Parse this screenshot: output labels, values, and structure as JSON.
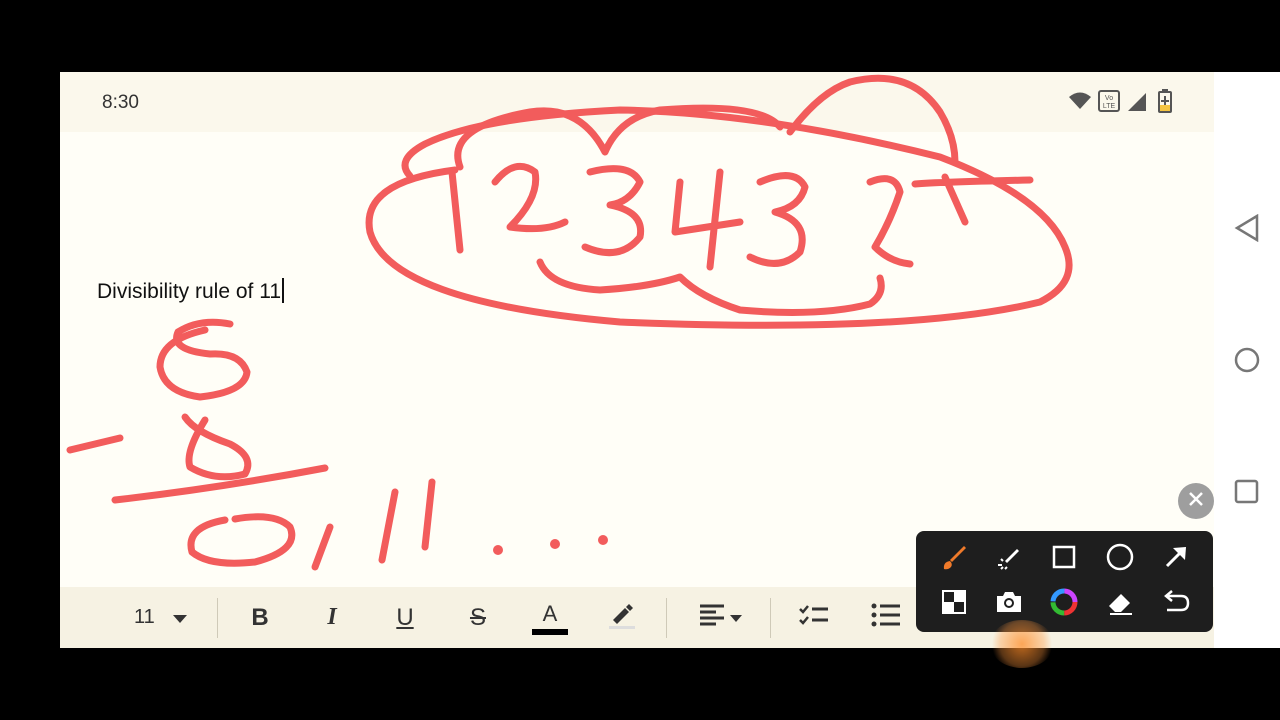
{
  "status_bar": {
    "time": "8:30",
    "icons": [
      "wifi-icon",
      "volte-icon",
      "signal-icon",
      "battery-charging-icon"
    ],
    "volte_text": "Vo LTE"
  },
  "document": {
    "text": "Divisibility rule of 11"
  },
  "handwriting": {
    "color": "#f25c5c",
    "marks": [
      {
        "id": "circled-number",
        "text": "1234327"
      },
      {
        "id": "subtraction",
        "text": "8 - 8 = 0, 11 . . ."
      }
    ]
  },
  "format_toolbar": {
    "font_size": "11",
    "buttons": [
      "bold",
      "italic",
      "underline",
      "strikethrough",
      "text-color",
      "highlight",
      "align",
      "checklist",
      "bullet-list"
    ],
    "bold": "B",
    "italic": "I",
    "underline": "U",
    "strikethrough": "S",
    "text_color": "A",
    "text_color_value": "#000000"
  },
  "pen_toolbar": {
    "tools": [
      "brush",
      "laser-pointer",
      "rectangle",
      "ellipse",
      "arrow",
      "pattern",
      "camera",
      "color-picker",
      "eraser",
      "undo"
    ],
    "active_tool": "brush",
    "active_color": "#f07a2a"
  },
  "nav_bar": {
    "buttons": [
      "back",
      "home",
      "recents"
    ]
  }
}
